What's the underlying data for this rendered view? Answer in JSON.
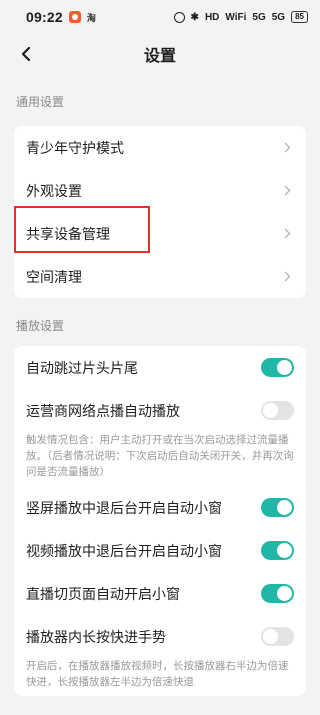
{
  "status_bar": {
    "time": "09:22",
    "taobao": "淘",
    "bt": "✱",
    "hd": "HD",
    "wifi": "WiFi",
    "sig1": "5G",
    "sig2": "5G",
    "battery": "85"
  },
  "header": {
    "title": "设置"
  },
  "sections": {
    "general": {
      "title": "通用设置",
      "items": [
        {
          "label": "青少年守护模式"
        },
        {
          "label": "外观设置"
        },
        {
          "label": "共享设备管理"
        },
        {
          "label": "空间清理"
        }
      ]
    },
    "playback": {
      "title": "播放设置",
      "items": [
        {
          "label": "自动跳过片头片尾",
          "on": true
        },
        {
          "label": "运营商网络点播自动播放",
          "on": false,
          "desc": "触发情况包含：用户主动打开或在当次启动选择过流量播放。（后者情况说明：下次启动后自动关闭开关，并再次询问是否流量播放）"
        },
        {
          "label": "竖屏播放中退后台开启自动小窗",
          "on": true
        },
        {
          "label": "视频播放中退后台开启自动小窗",
          "on": true
        },
        {
          "label": "直播切页面自动开启小窗",
          "on": true
        },
        {
          "label": "播放器内长按快进手势",
          "on": false,
          "desc": "开启后，在播放器播放视频时，长按播放器右半边为倍速快进，长按播放器左半边为倍速快退"
        }
      ]
    }
  },
  "colors": {
    "toggle_on": "#1fb8a8",
    "toggle_off": "#e3e3e6",
    "highlight": "#e0312a"
  }
}
